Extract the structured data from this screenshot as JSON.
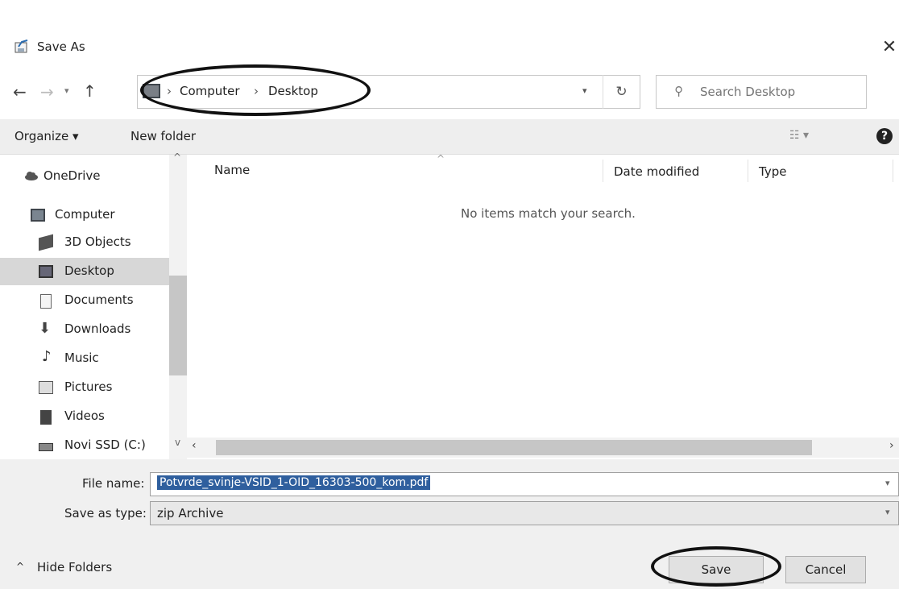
{
  "window": {
    "title": "Save As"
  },
  "addressbar": {
    "sep": "›",
    "crumbs": [
      "Computer",
      "Desktop"
    ]
  },
  "search": {
    "placeholder": "Search Desktop"
  },
  "toolbar": {
    "organize_label": "Organize ▾",
    "new_folder_label": "New folder"
  },
  "sidebar": {
    "items": [
      {
        "label": "OneDrive",
        "icon": "cloud-icon"
      },
      {
        "label": "Computer",
        "icon": "computer-icon"
      },
      {
        "label": "3D Objects",
        "icon": "cube-icon"
      },
      {
        "label": "Desktop",
        "icon": "desktop-icon",
        "selected": true
      },
      {
        "label": "Documents",
        "icon": "document-icon"
      },
      {
        "label": "Downloads",
        "icon": "download-icon"
      },
      {
        "label": "Music",
        "icon": "music-note-icon"
      },
      {
        "label": "Pictures",
        "icon": "picture-icon"
      },
      {
        "label": "Videos",
        "icon": "video-icon"
      },
      {
        "label": "Novi SSD (C:)",
        "icon": "drive-icon"
      }
    ]
  },
  "filelist": {
    "columns": [
      "Name",
      "Date modified",
      "Type"
    ],
    "empty_message": "No items match your search."
  },
  "form": {
    "filename_label": "File name:",
    "filename_value": "Potvrde_svinje-VSID_1-OID_16303-500_kom.pdf",
    "savetype_label": "Save as type:",
    "savetype_value": "zip Archive"
  },
  "footer": {
    "hide_folders_label": "Hide Folders",
    "save_label": "Save",
    "cancel_label": "Cancel"
  },
  "colors": {
    "selection": "#2f5f9e",
    "sidebar_selected": "#d7d7d7",
    "toolbar_bg": "#eeeeee",
    "footer_bg": "#f0f0f0"
  }
}
